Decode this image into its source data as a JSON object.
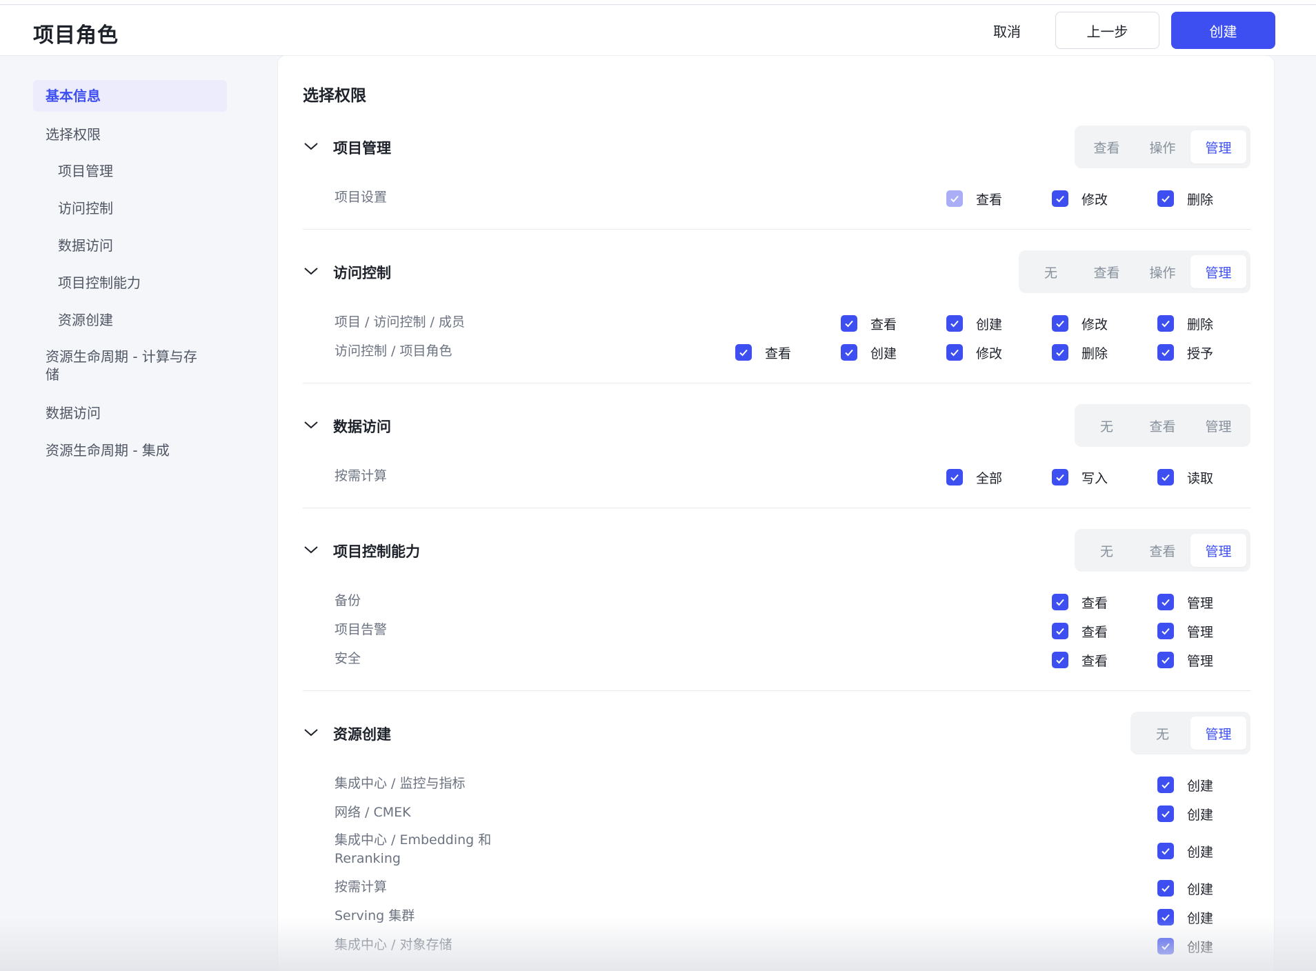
{
  "header": {
    "title": "项目角色",
    "cancel": "取消",
    "prev": "上一步",
    "create": "创建"
  },
  "sidebar": {
    "items": [
      {
        "label": "基本信息"
      },
      {
        "label": "选择权限"
      },
      {
        "label": "项目管理"
      },
      {
        "label": "访问控制"
      },
      {
        "label": "数据访问"
      },
      {
        "label": "项目控制能力"
      },
      {
        "label": "资源创建"
      },
      {
        "label": "资源生命周期 - 计算与存储"
      },
      {
        "label": "数据访问"
      },
      {
        "label": "资源生命周期 - 集成"
      }
    ],
    "active_index": 0
  },
  "panel": {
    "title": "选择权限"
  },
  "sections": [
    {
      "title": "项目管理",
      "options": [
        "查看",
        "操作",
        "管理"
      ],
      "selected": "管理",
      "rows": [
        {
          "label": "项目设置",
          "perms": [
            "查看",
            "修改",
            "删除"
          ]
        }
      ]
    },
    {
      "title": "访问控制",
      "options": [
        "无",
        "查看",
        "操作",
        "管理"
      ],
      "selected": "管理",
      "rows": [
        {
          "label": "项目 / 访问控制 / 成员",
          "perms": [
            "查看",
            "创建",
            "修改",
            "删除"
          ]
        },
        {
          "label": "访问控制 / 项目角色",
          "perms": [
            "查看",
            "创建",
            "修改",
            "删除",
            "授予"
          ]
        }
      ]
    },
    {
      "title": "数据访问",
      "options": [
        "无",
        "查看",
        "管理"
      ],
      "selected": "",
      "rows": [
        {
          "label": "按需计算",
          "perms": [
            "全部",
            "写入",
            "读取"
          ]
        }
      ]
    },
    {
      "title": "项目控制能力",
      "options": [
        "无",
        "查看",
        "管理"
      ],
      "selected": "管理",
      "rows": [
        {
          "label": "备份",
          "perms": [
            "查看",
            "管理"
          ]
        },
        {
          "label": "项目告警",
          "perms": [
            "查看",
            "管理"
          ]
        },
        {
          "label": "安全",
          "perms": [
            "查看",
            "管理"
          ]
        }
      ]
    },
    {
      "title": "资源创建",
      "options": [
        "无",
        "管理"
      ],
      "selected": "管理",
      "rows": [
        {
          "label": "集成中心 / 监控与指标",
          "perms": [
            "创建"
          ]
        },
        {
          "label": "网络 / CMEK",
          "perms": [
            "创建"
          ]
        },
        {
          "label": "集成中心 / Embedding 和 Reranking",
          "perms": [
            "创建"
          ]
        },
        {
          "label": "按需计算",
          "perms": [
            "创建"
          ]
        },
        {
          "label": "Serving 集群",
          "perms": [
            "创建"
          ]
        },
        {
          "label": "集成中心 / 对象存储",
          "perms": [
            "创建"
          ]
        }
      ]
    }
  ],
  "colors": {
    "accent": "#3d4ff1",
    "accent_light": "#ececfd",
    "disabled_check": "#a9aef7"
  }
}
